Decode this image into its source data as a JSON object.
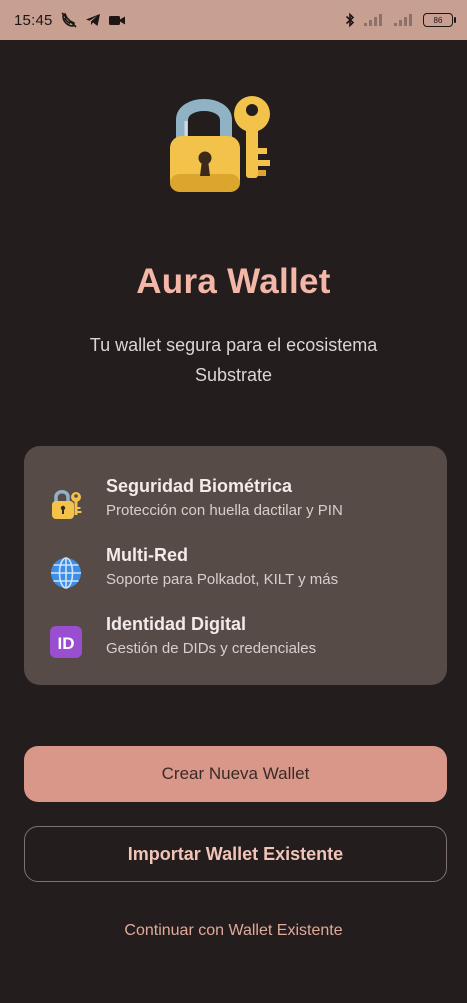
{
  "status_bar": {
    "time": "15:45",
    "icons": [
      "muted-call-icon",
      "telegram-icon",
      "video-icon"
    ],
    "right_icons": [
      "bluetooth-icon",
      "signal-icon",
      "signal-icon"
    ],
    "battery": "86"
  },
  "app": {
    "icon": "lock-with-key-icon",
    "title": "Aura Wallet",
    "subtitle": "Tu wallet segura para el ecosistema Substrate"
  },
  "features": [
    {
      "icon": "locked-with-key-icon",
      "title": "Seguridad Biométrica",
      "description": "Protección con huella dactilar y PIN"
    },
    {
      "icon": "globe-icon",
      "title": "Multi-Red",
      "description": "Soporte para Polkadot, KILT y más"
    },
    {
      "icon": "id-icon",
      "title": "Identidad Digital",
      "description": "Gestión de DIDs y credenciales"
    }
  ],
  "actions": {
    "create_label": "Crear Nueva Wallet",
    "import_label": "Importar Wallet Existente",
    "continue_label": "Continuar con Wallet Existente"
  },
  "colors": {
    "background": "#231d1d",
    "accent": "#f4b6a6",
    "primary_button": "#d9978a",
    "card": "#574b48"
  }
}
